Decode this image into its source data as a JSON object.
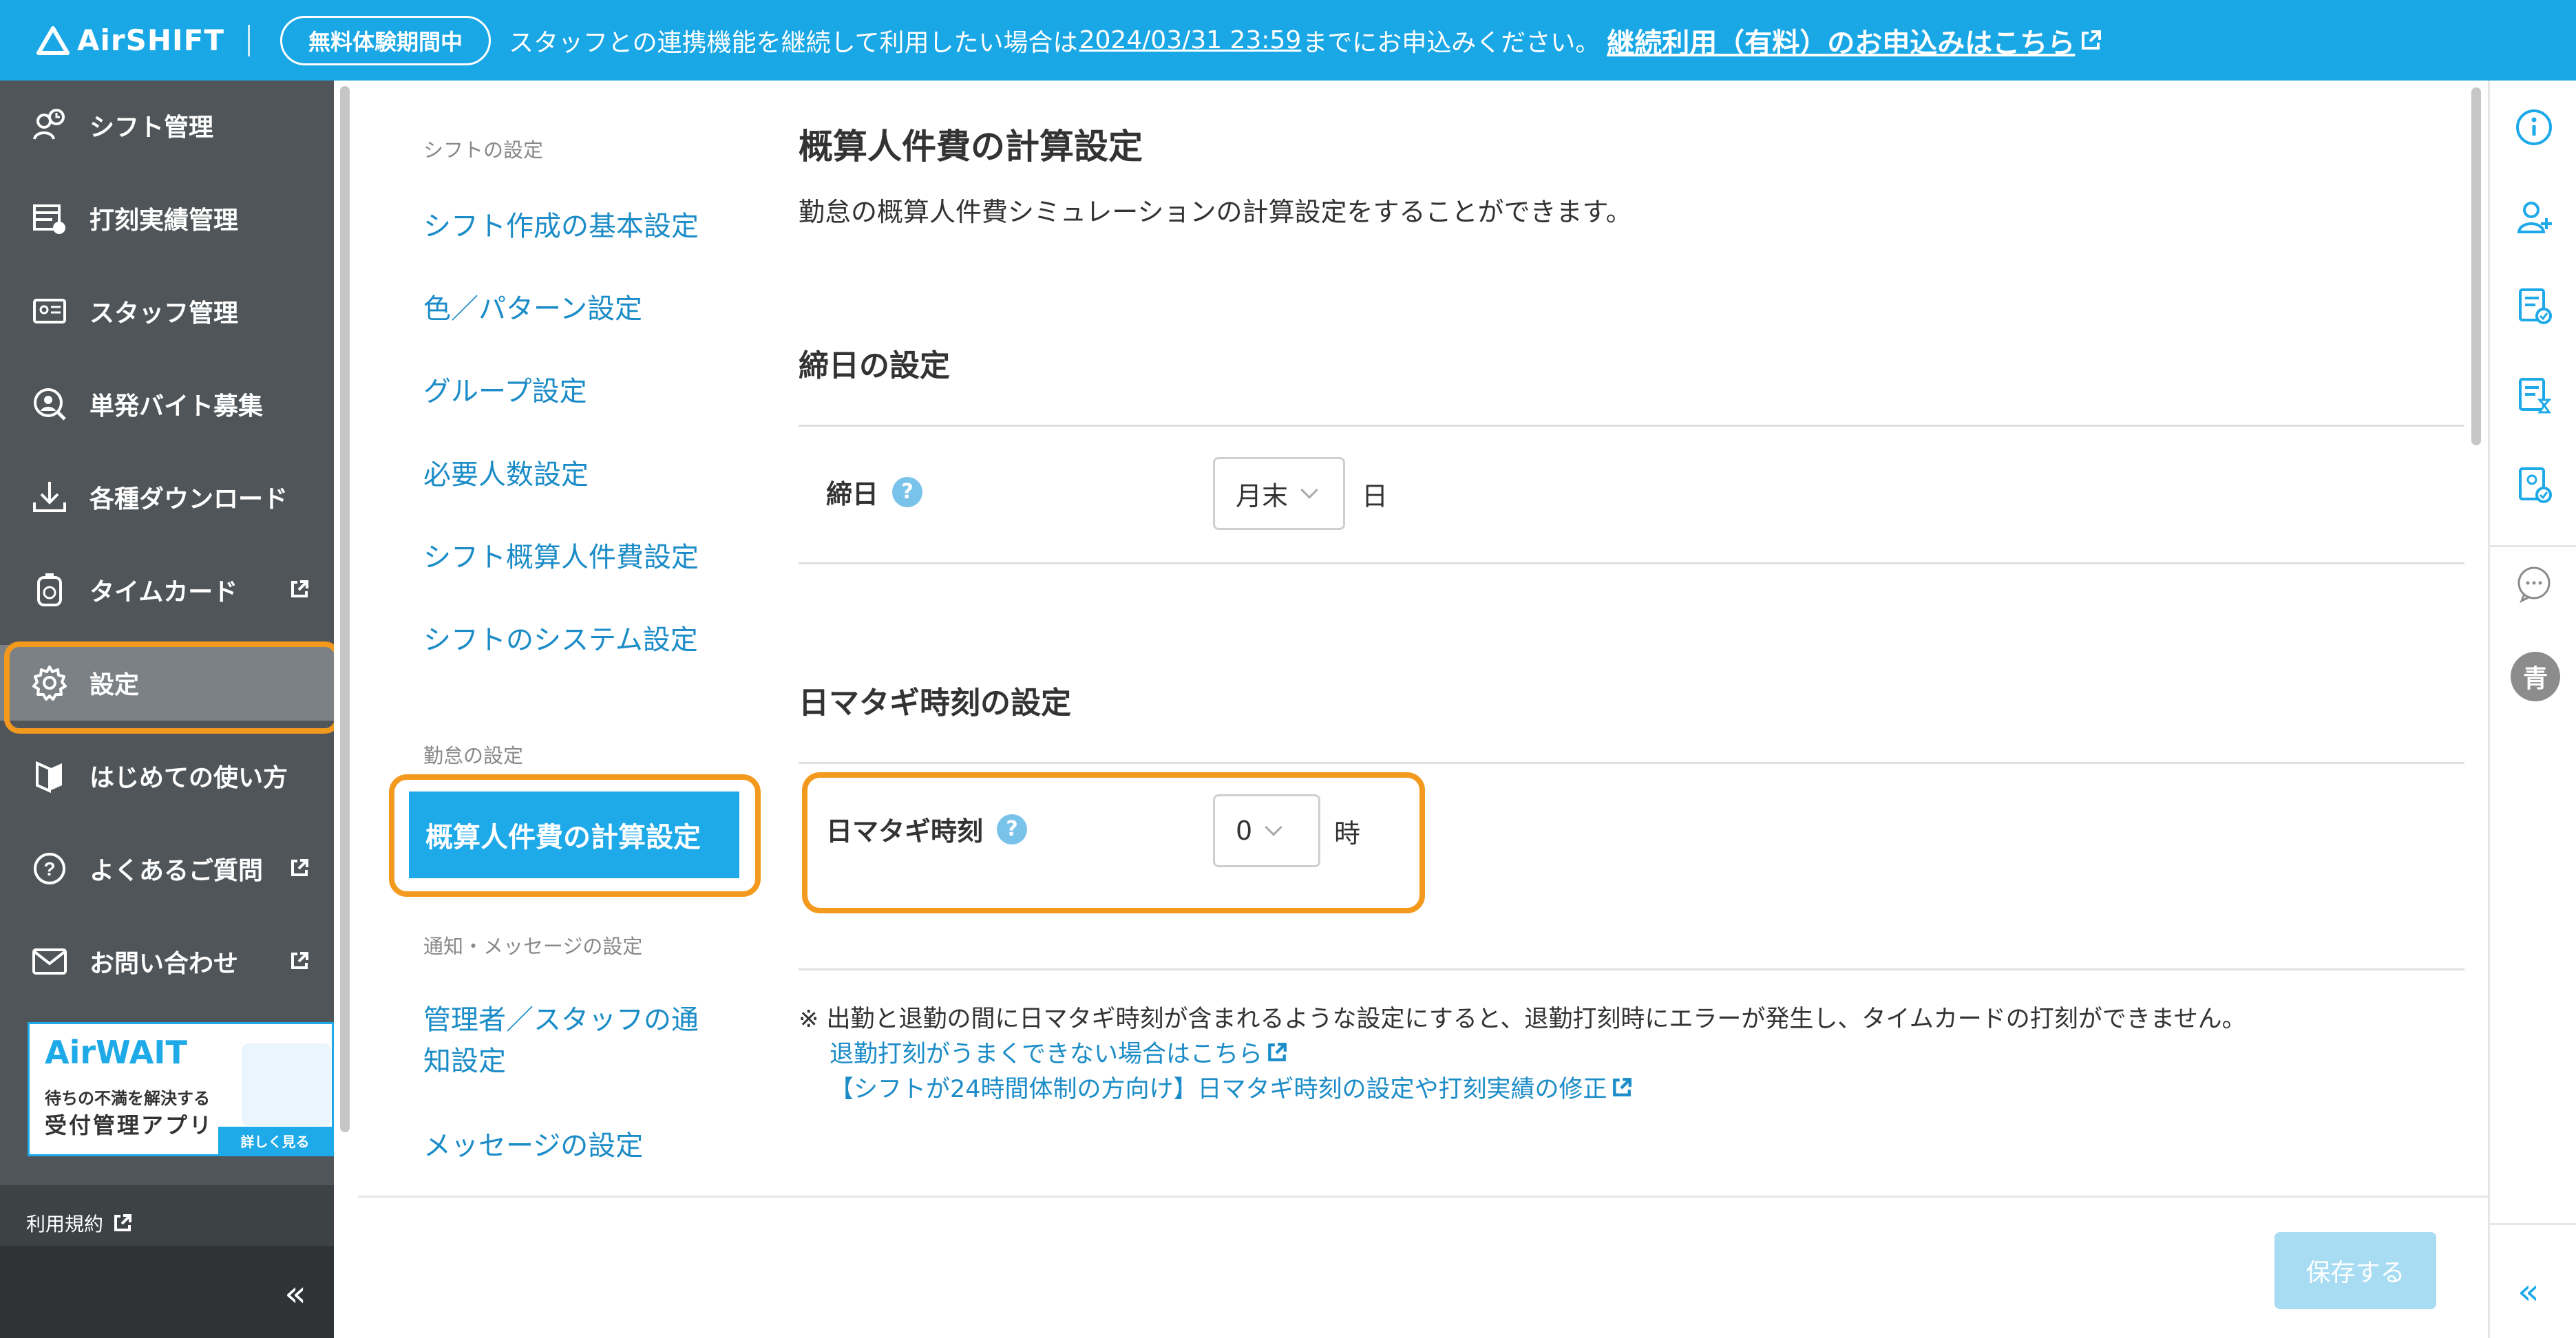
{
  "topbar": {
    "logo": "AirSHIFT",
    "trial_label": "無料体験期間中",
    "notice_pre": "スタッフとの連携機能を継続して利用したい場合は",
    "notice_date": "2024/03/31 23:59",
    "notice_post": "までにお申込みください。",
    "cta_label": "継続利用（有料）のお申込みはこちら"
  },
  "sidebar": {
    "items": [
      {
        "label": "シフト管理",
        "icon": "shift-icon"
      },
      {
        "label": "打刻実績管理",
        "icon": "timecard-record-icon"
      },
      {
        "label": "スタッフ管理",
        "icon": "staff-id-icon"
      },
      {
        "label": "単発バイト募集",
        "icon": "recruit-icon"
      },
      {
        "label": "各種ダウンロード",
        "icon": "download-icon"
      },
      {
        "label": "タイムカード",
        "icon": "timecard-icon"
      },
      {
        "label": "設定",
        "icon": "gear-icon"
      },
      {
        "label": "はじめての使い方",
        "icon": "beginner-icon"
      },
      {
        "label": "よくあるご質問",
        "icon": "question-icon"
      },
      {
        "label": "お問い合わせ",
        "icon": "mail-icon"
      }
    ],
    "banner": {
      "title": "AirWAIT",
      "subtitle": "待ちの不満を解決する",
      "main": "受付管理アプリ",
      "button": "詳しく見る"
    },
    "terms": "利用規約",
    "collapse": "«"
  },
  "settings_nav": {
    "shift_heading": "シフトの設定",
    "shift_links": [
      "シフト作成の基本設定",
      "色／パターン設定",
      "グループ設定",
      "必要人数設定",
      "シフト概算人件費設定",
      "シフトのシステム設定"
    ],
    "attendance_heading": "勤怠の設定",
    "active_link": "概算人件費の計算設定",
    "notify_heading": "通知・メッセージの設定",
    "notify_link_1": "管理者／スタッフの通",
    "notify_link_1b": "知設定",
    "notify_link_2": "メッセージの設定"
  },
  "main": {
    "title": "概算人件費の計算設定",
    "description": "勤怠の概算人件費シミュレーションの計算設定をすることができます。",
    "closing_section": "締日の設定",
    "closing_label": "締日",
    "closing_value": "月末",
    "closing_unit": "日",
    "crossday_section": "日マタギ時刻の設定",
    "crossday_label": "日マタギ時刻",
    "crossday_value": "0",
    "crossday_unit": "時",
    "note": "※ 出勤と退勤の間に日マタギ時刻が含まれるような設定にすると、退勤打刻時にエラーが発生し、タイムカードの打刻ができません。",
    "note_link_1": "退勤打刻がうまくできない場合はこちら",
    "note_link_2": "【シフトが24時間体制の方向け】日マタギ時刻の設定や打刻実績の修正",
    "help_glyph": "?"
  },
  "footer": {
    "save_label": "保存する"
  },
  "rail": {
    "icons": [
      "info-icon",
      "add-user-icon",
      "doc-check-icon",
      "doc-hourglass-icon",
      "person-check-icon",
      "chat-icon"
    ],
    "avatar": "青",
    "collapse": "«"
  },
  "colors": {
    "brand": "#19a7e6",
    "highlight": "#f39a1e",
    "sidebar": "#4f5558",
    "link": "#1b8cc7"
  }
}
